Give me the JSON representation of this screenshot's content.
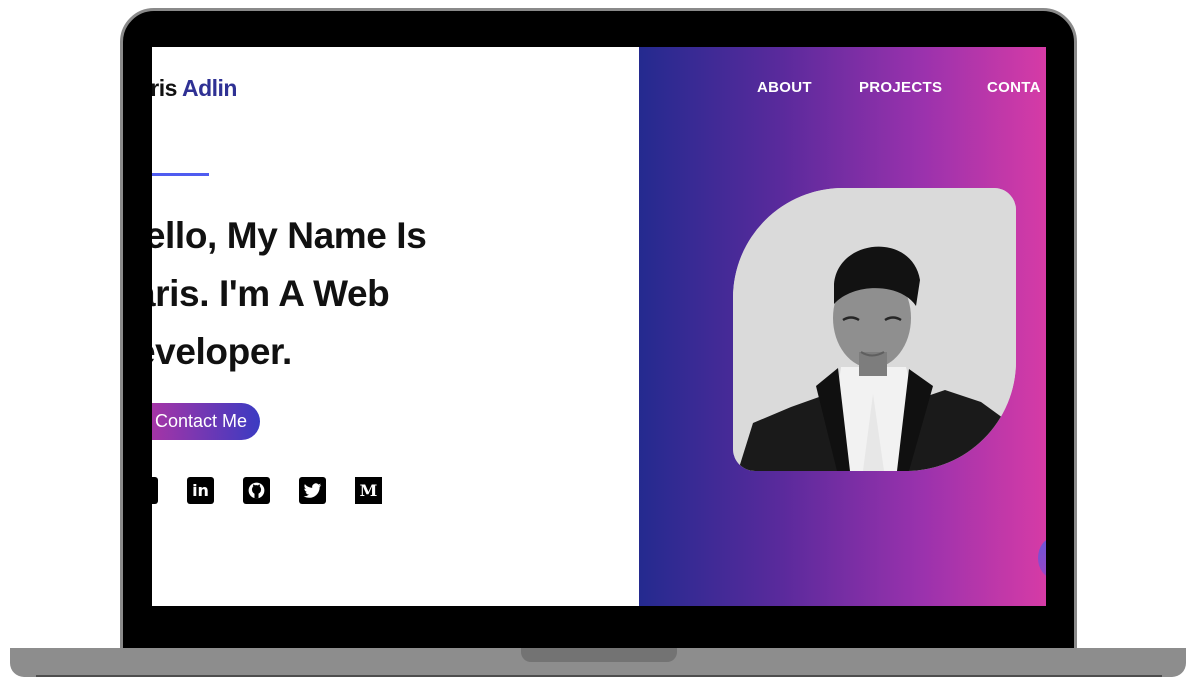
{
  "site": {
    "brand_first": "aris",
    "brand_last": "Adlin",
    "hero_lines": [
      "lello, My Name Is",
      "aris. I'm A Web",
      "eveloper."
    ],
    "cta_label": "Contact Me"
  },
  "nav": {
    "items": [
      {
        "label": "ABOUT"
      },
      {
        "label": "PROJECTS"
      },
      {
        "label": "CONTA"
      }
    ]
  },
  "social": {
    "icons": [
      "partial-social-icon",
      "linkedin-icon",
      "github-icon",
      "twitter-icon",
      "medium-icon"
    ],
    "linkedin_text": "in",
    "medium_text": "M"
  },
  "colors": {
    "brand_accent": "#2f3194",
    "gradient_start": "#242a8f",
    "gradient_end": "#d63ba6"
  }
}
